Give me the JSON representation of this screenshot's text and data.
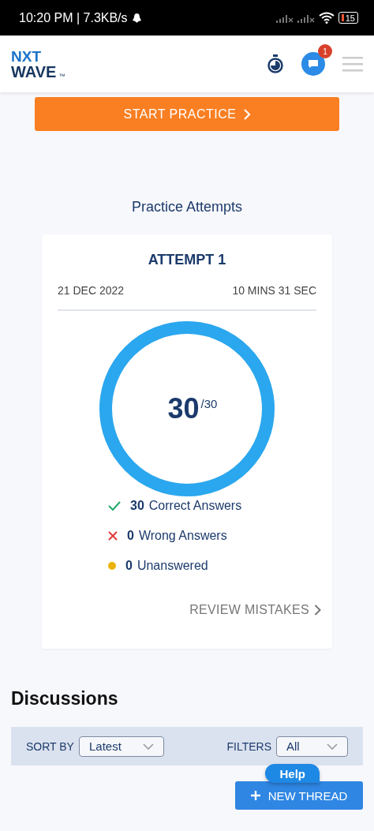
{
  "status_bar": {
    "time": "10:20 PM | 7.3KB/s",
    "battery": "15"
  },
  "header": {
    "logo_top": "NXT",
    "logo_bottom": "WAVE",
    "logo_mark": "™",
    "chat_badge": "1"
  },
  "start_button": "START PRACTICE",
  "section_title": "Practice Attempts",
  "attempt": {
    "title": "ATTEMPT 1",
    "date": "21 DEC 2022",
    "duration": "10 MINS 31 SEC",
    "score": "30",
    "total": "/30",
    "level": 1,
    "results": [
      {
        "kind": "correct",
        "count": "30",
        "label": "Correct Answers"
      },
      {
        "kind": "wrong",
        "count": "0",
        "label": "Wrong Answers"
      },
      {
        "kind": "unanswered",
        "count": "0",
        "label": "Unanswered"
      }
    ],
    "review": "REVIEW MISTAKES"
  },
  "discussions": {
    "title": "Discussions",
    "sort_label": "SORT BY",
    "sort_value": "Latest",
    "filter_label": "FILTERS",
    "filter_value": "All",
    "new_thread": "NEW THREAD",
    "help": "Help"
  }
}
